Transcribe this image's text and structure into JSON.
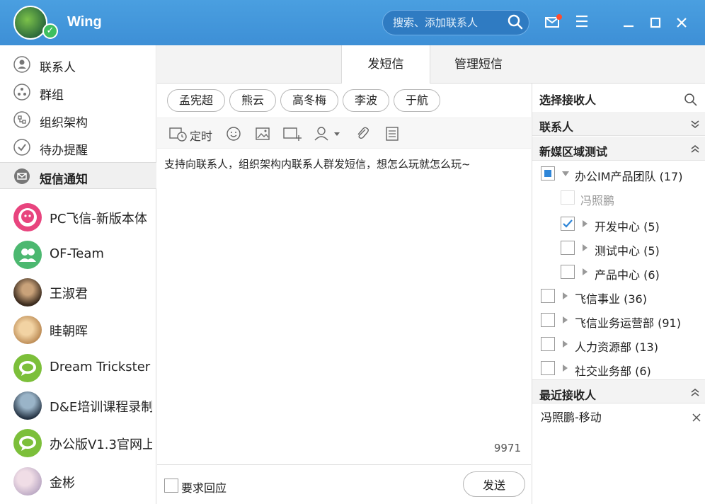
{
  "app": {
    "username": "Wing",
    "search_placeholder": "搜索、添加联系人",
    "accent": "#3d8fd6"
  },
  "sidebar": {
    "nav": [
      {
        "label": "联系人",
        "icon": "contact-icon"
      },
      {
        "label": "群组",
        "icon": "group-icon"
      },
      {
        "label": "组织架构",
        "icon": "org-icon"
      },
      {
        "label": "待办提醒",
        "icon": "todo-icon"
      },
      {
        "label": "短信通知",
        "icon": "sms-icon",
        "active": true
      }
    ],
    "chats": [
      {
        "label": "PC飞信-新版本体"
      },
      {
        "label": "OF-Team"
      },
      {
        "label": "王淑君"
      },
      {
        "label": "眭朝晖"
      },
      {
        "label": "Dream Trickster"
      },
      {
        "label": "D&E培训课程录制"
      },
      {
        "label": "办公版V1.3官网上"
      },
      {
        "label": "金彬"
      }
    ]
  },
  "tabs": {
    "send": "发短信",
    "manage": "管理短信"
  },
  "recipients": [
    "孟宪超",
    "熊云",
    "高冬梅",
    "李波",
    "于航"
  ],
  "toolbar": {
    "timer_label": "定时"
  },
  "compose": {
    "text": "支持向联系人，组织架构内联系人群发短信，想怎么玩就怎么玩~",
    "remaining": "9971"
  },
  "footer": {
    "require_reply": "要求回应",
    "send": "发送"
  },
  "right_panel": {
    "title": "选择接收人",
    "contacts_section": "联系人",
    "org_section": "新媒区域测试",
    "tree": [
      {
        "label": "办公IM产品团队 (17)",
        "state": "partial"
      },
      {
        "label": "冯照鹏",
        "state": "disabled"
      },
      {
        "label": "开发中心 (5)",
        "state": "checked"
      },
      {
        "label": "测试中心 (5)",
        "state": "unchecked"
      },
      {
        "label": "产品中心 (6)",
        "state": "unchecked"
      },
      {
        "label": "飞信事业 (36)",
        "state": "unchecked"
      },
      {
        "label": "飞信业务运营部 (91)",
        "state": "unchecked"
      },
      {
        "label": "人力资源部 (13)",
        "state": "unchecked"
      },
      {
        "label": "社交业务部 (6)",
        "state": "unchecked"
      }
    ],
    "recent_section": "最近接收人",
    "recent": [
      {
        "label": "冯照鹏-移动"
      }
    ]
  }
}
